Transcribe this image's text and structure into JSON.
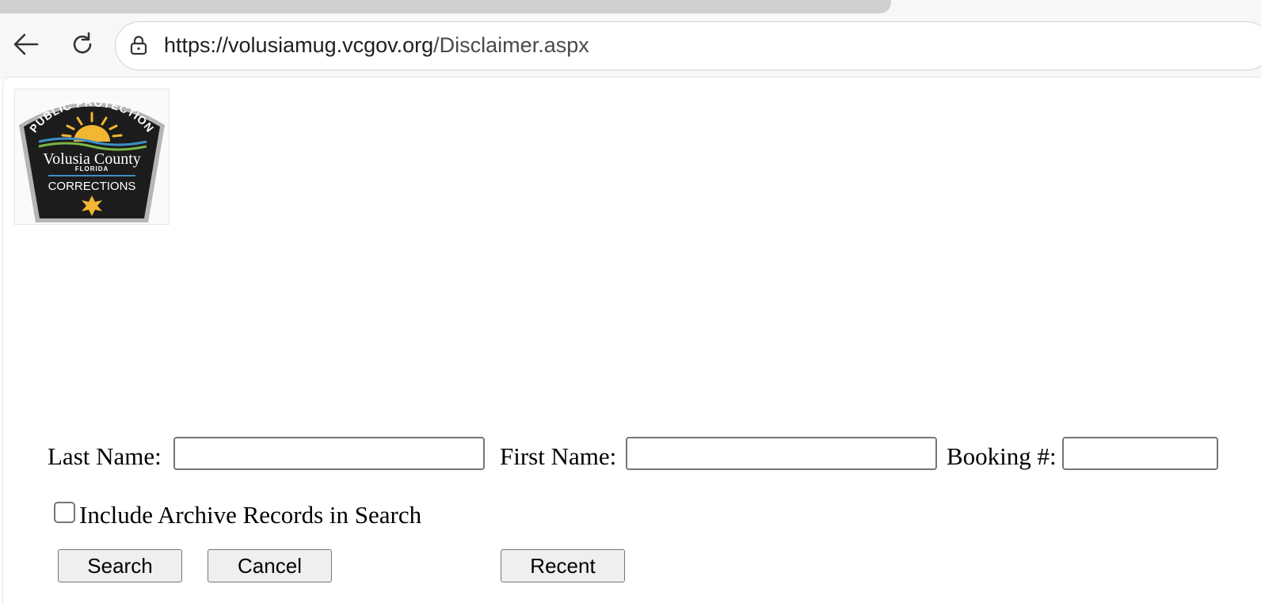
{
  "browser": {
    "url_host": "https://volusiamug.vcgov.org",
    "url_path": "/Disclaimer.aspx",
    "back_icon": "back-arrow-icon",
    "reload_icon": "reload-icon",
    "lock_icon": "lock-icon"
  },
  "logo": {
    "top_text": "PUBLIC PROTECTION",
    "county": "Volusia County",
    "state": "FLORIDA",
    "department": "CORRECTIONS"
  },
  "form": {
    "last_name_label": "Last Name:",
    "last_name_value": "",
    "first_name_label": "First Name:",
    "first_name_value": "",
    "booking_label": "Booking #:",
    "booking_value": "",
    "archive_label": "Include Archive Records in Search",
    "archive_checked": false,
    "search_button": "Search",
    "cancel_button": "Cancel",
    "recent_button": "Recent"
  },
  "colors": {
    "badge_background": "#1c1c1c",
    "badge_border": "#b5b5b5",
    "sun": "#f2b632",
    "wave_blue": "#3c8fc7",
    "wave_green": "#7ab648"
  }
}
